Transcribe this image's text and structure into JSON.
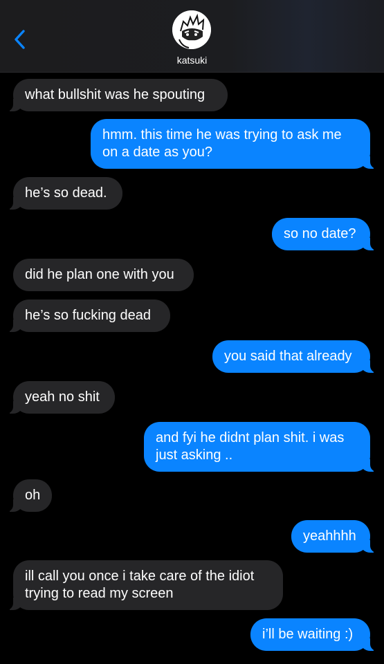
{
  "header": {
    "contact_name": "katsuki",
    "back_icon": "chevron-left-icon",
    "accent_color": "#0a84ff"
  },
  "messages": [
    {
      "from": "them",
      "text": "what bullshit was he spouting"
    },
    {
      "from": "me",
      "text": "hmm. this time he was trying to ask me on a date as you?"
    },
    {
      "from": "them",
      "text": "he’s so dead."
    },
    {
      "from": "me",
      "text": "so no date?"
    },
    {
      "from": "them",
      "text": "did he plan one with you"
    },
    {
      "from": "them",
      "text": "he’s so fucking dead"
    },
    {
      "from": "me",
      "text": "you said that already"
    },
    {
      "from": "them",
      "text": "yeah no shit"
    },
    {
      "from": "me",
      "text": "and fyi he didnt plan shit. i was just asking .."
    },
    {
      "from": "them",
      "text": "oh"
    },
    {
      "from": "me",
      "text": "yeahhhh"
    },
    {
      "from": "them",
      "text": "ill call you once i take care of the idiot trying to read my screen"
    },
    {
      "from": "me",
      "text": "i’ll be waiting :)"
    }
  ],
  "colors": {
    "sent_bubble": "#0a84ff",
    "received_bubble": "#262628",
    "background": "#000000"
  }
}
